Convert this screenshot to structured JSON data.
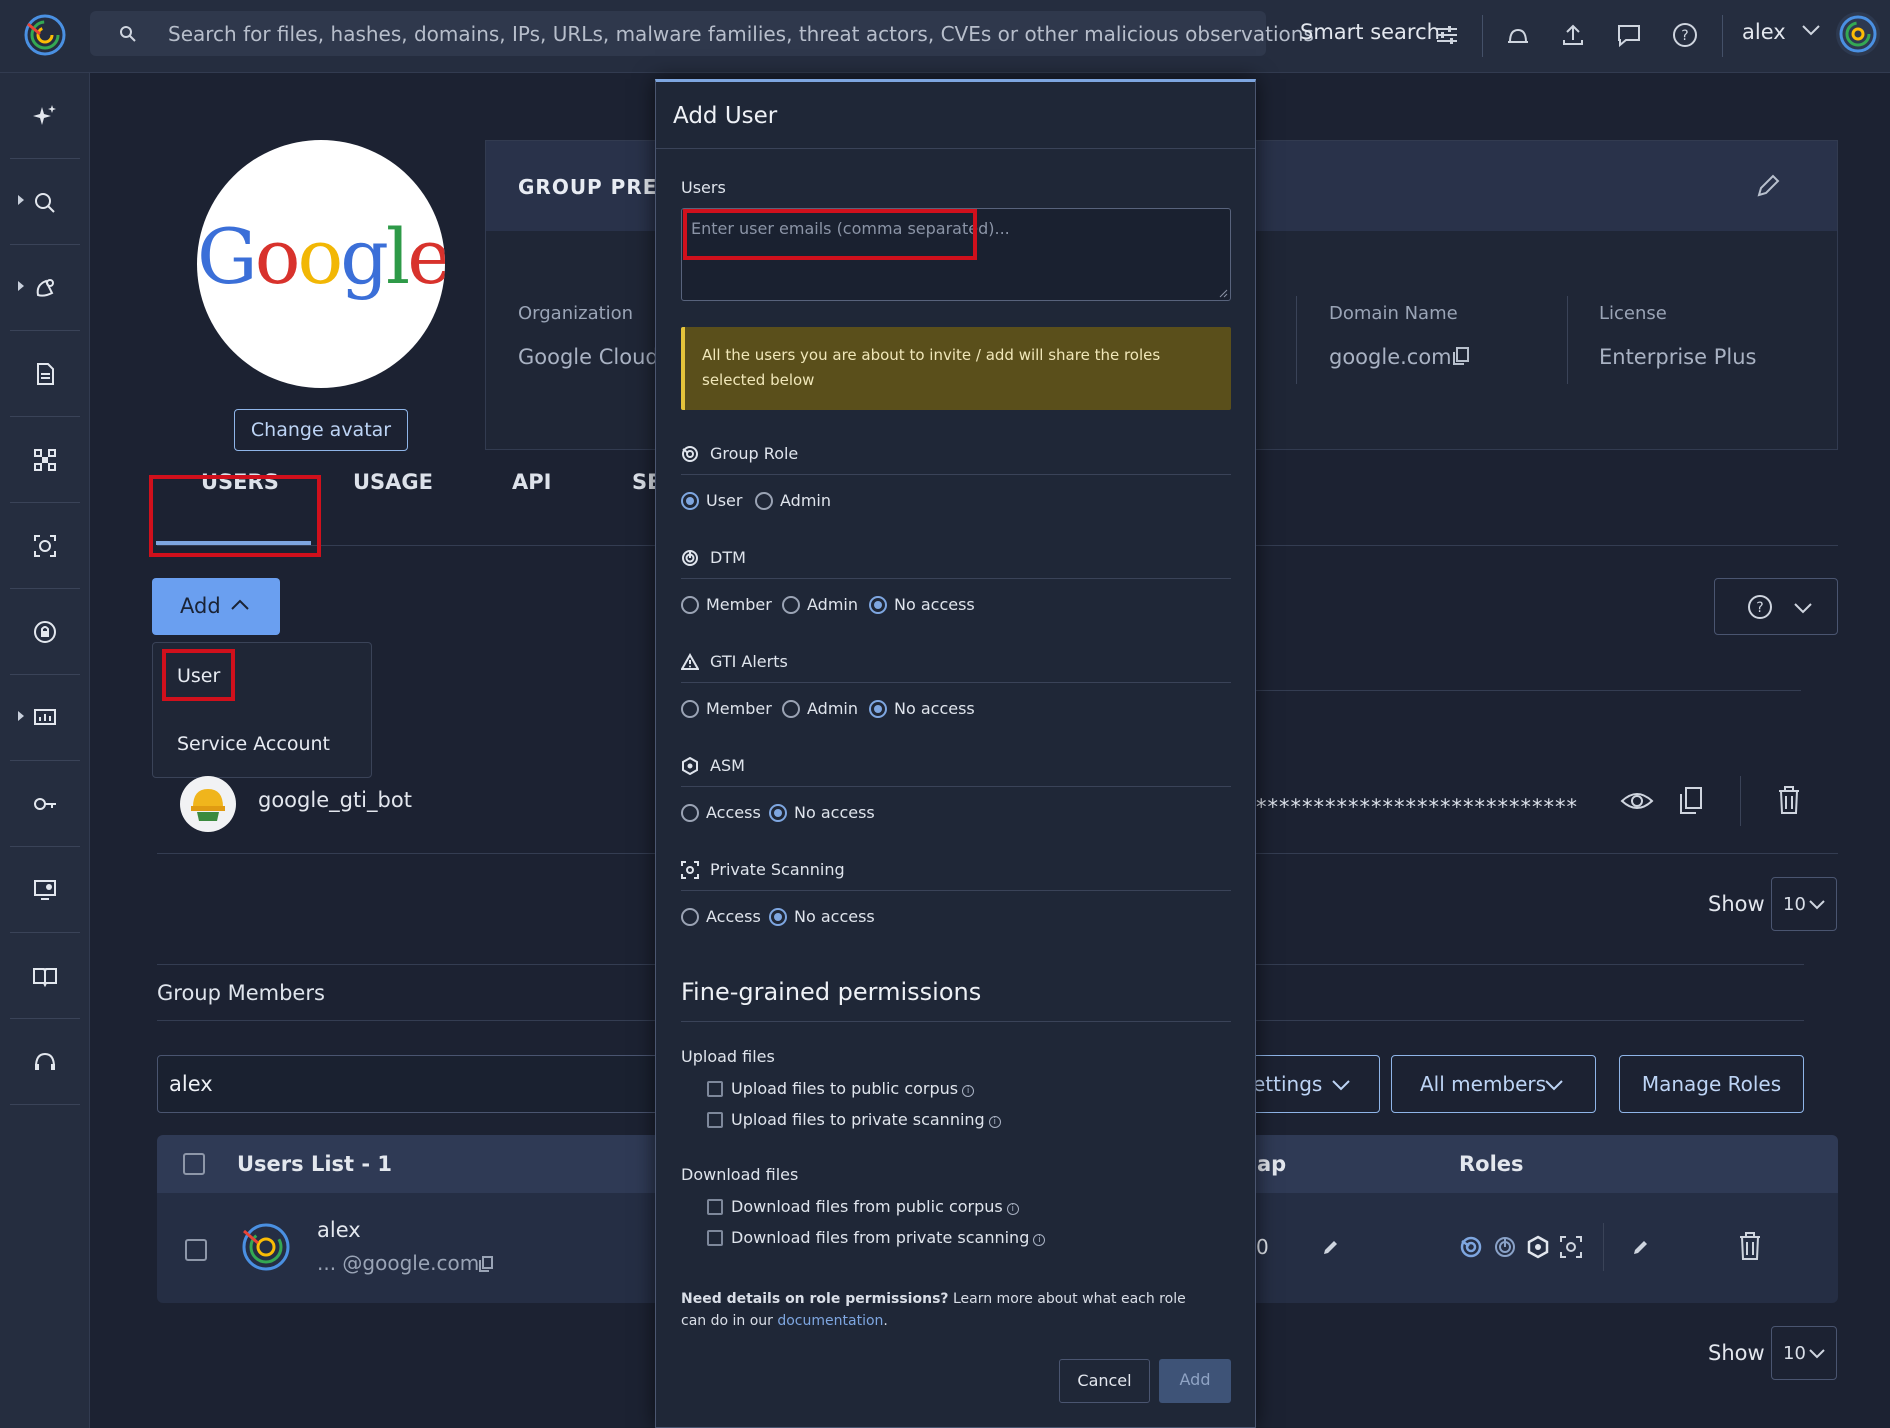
{
  "topbar": {
    "search_placeholder": "Search for files, hashes, domains, IPs, URLs, malware families, threat actors, CVEs or other malicious observations",
    "smart_search_label": "Smart search",
    "username": "alex"
  },
  "profile": {
    "avatar_text": "Google",
    "change_avatar_label": "Change avatar"
  },
  "group_card": {
    "title": "GROUP PREFE",
    "organization_label": "Organization",
    "organization_value": "Google Cloud",
    "domain_label": "Domain Name",
    "domain_value": "google.com",
    "license_label": "License",
    "license_value": "Enterprise Plus"
  },
  "tabs": [
    "USERS",
    "USAGE",
    "API",
    "SE"
  ],
  "add_button_label": "Add",
  "add_menu": [
    "User",
    "Service Account"
  ],
  "service_account": {
    "name": "google_gti_bot",
    "masked_key": "****************************"
  },
  "pagination": {
    "show_label": "Show",
    "page_size": "10"
  },
  "members": {
    "section_title": "Group Members",
    "search_value": "alex",
    "filter_settings_label": "ettings",
    "filter_members_label": "All members",
    "manage_roles_label": "Manage Roles",
    "table_title": "Users List - 1",
    "col_cap_partial": "ap",
    "col_roles": "Roles",
    "rows": [
      {
        "name": "alex",
        "email": "... @google.com",
        "partial_value": "0"
      }
    ]
  },
  "modal": {
    "title": "Add User",
    "users_label": "Users",
    "users_placeholder": "Enter user emails (comma separated)...",
    "notice": "All the users you are about to invite / add will share the roles selected below",
    "sections": [
      {
        "title": "Group Role",
        "options": [
          "User",
          "Admin"
        ],
        "selected": 0
      },
      {
        "title": "DTM",
        "options": [
          "Member",
          "Admin",
          "No access"
        ],
        "selected": 2
      },
      {
        "title": "GTI Alerts",
        "options": [
          "Member",
          "Admin",
          "No access"
        ],
        "selected": 2
      },
      {
        "title": "ASM",
        "options": [
          "Access",
          "No access"
        ],
        "selected": 1
      },
      {
        "title": "Private Scanning",
        "options": [
          "Access",
          "No access"
        ],
        "selected": 1
      }
    ],
    "fine_grained_title": "Fine-grained permissions",
    "upload_title": "Upload files",
    "upload_options": [
      "Upload files to public corpus",
      "Upload files to private scanning"
    ],
    "download_title": "Download files",
    "download_options": [
      "Download files from public corpus",
      "Download files from private scanning"
    ],
    "help_bold": "Need details on role permissions?",
    "help_text": " Learn more about what each role can do in our ",
    "help_link": "documentation",
    "help_end": ".",
    "cancel_label": "Cancel",
    "add_label": "Add"
  },
  "colors": {
    "accent": "#7ea6e0",
    "highlight": "#d0101c",
    "notice_bg": "#5a4f1b"
  }
}
